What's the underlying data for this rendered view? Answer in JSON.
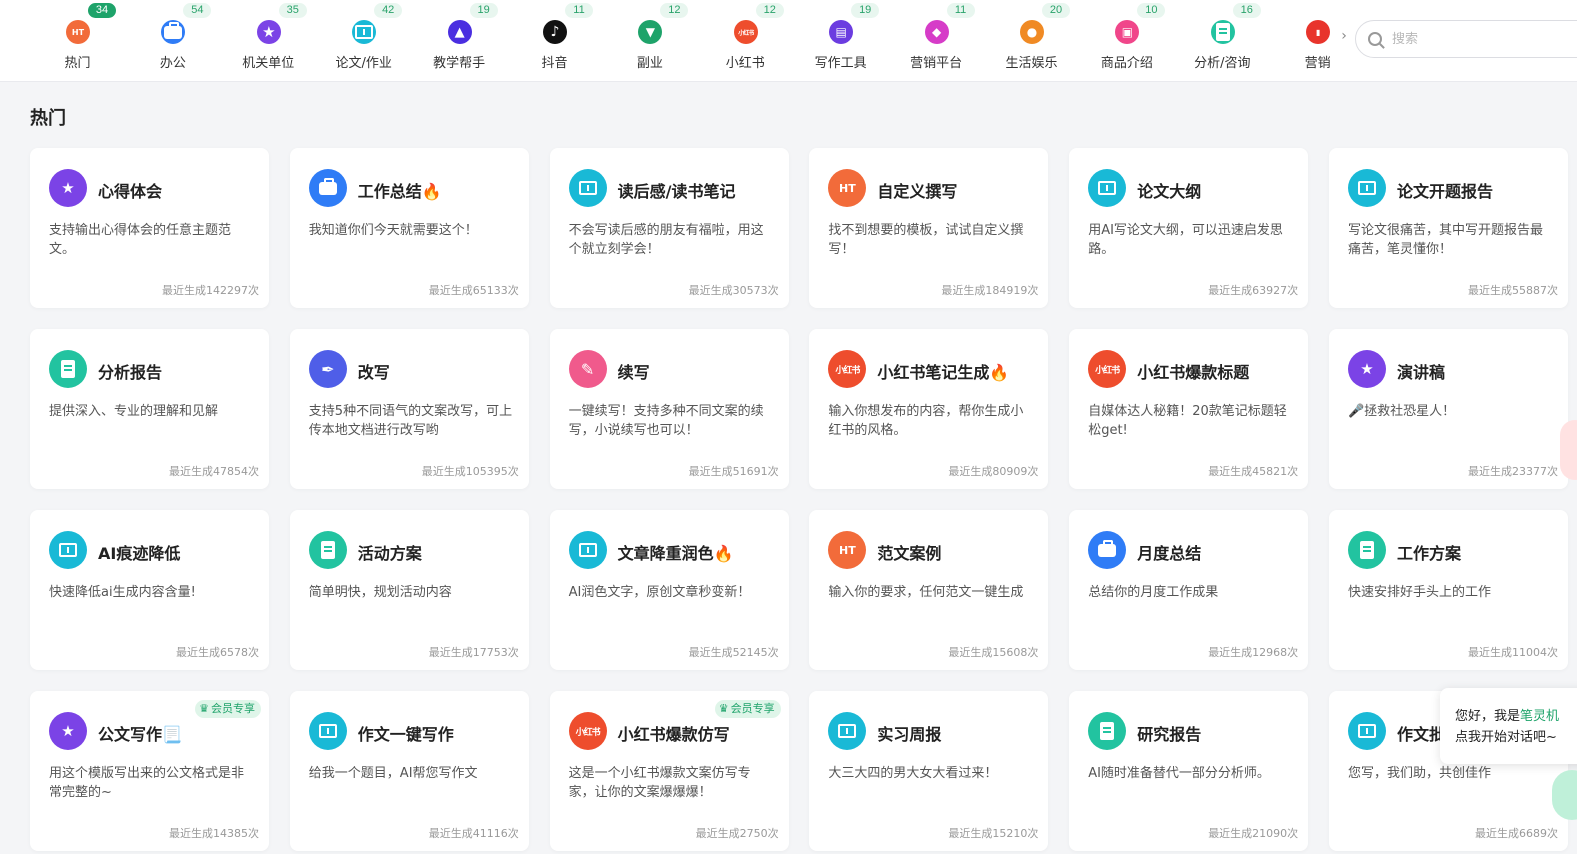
{
  "categories": [
    {
      "label": "热门",
      "badge": "34",
      "color": "#f26b3a",
      "glyph": "HT",
      "badge_dark": true
    },
    {
      "label": "办公",
      "badge": "54",
      "color": "#2f7cf6",
      "glyph": "briefcase"
    },
    {
      "label": "机关单位",
      "badge": "35",
      "color": "#7b43e6",
      "glyph": "star"
    },
    {
      "label": "论文/作业",
      "badge": "42",
      "color": "#19b9d6",
      "glyph": "book"
    },
    {
      "label": "教学帮手",
      "badge": "19",
      "color": "#4a2ee0",
      "glyph": "cap"
    },
    {
      "label": "抖音",
      "badge": "11",
      "color": "#111111",
      "glyph": "note"
    },
    {
      "label": "副业",
      "badge": "12",
      "color": "#1ea36a",
      "glyph": "tie"
    },
    {
      "label": "小红书",
      "badge": "12",
      "color": "#ee4d2d",
      "glyph": "xhs"
    },
    {
      "label": "写作工具",
      "badge": "19",
      "color": "#6b3ce0",
      "glyph": "notebook"
    },
    {
      "label": "营销平台",
      "badge": "11",
      "color": "#d63cc8",
      "glyph": "tag"
    },
    {
      "label": "生活娱乐",
      "badge": "20",
      "color": "#f08a24",
      "glyph": "mic"
    },
    {
      "label": "商品介绍",
      "badge": "10",
      "color": "#f0468a",
      "glyph": "bag"
    },
    {
      "label": "分析/咨询",
      "badge": "16",
      "color": "#22c3a0",
      "glyph": "doc"
    },
    {
      "label": "营销",
      "badge": "",
      "color": "#e8342c",
      "glyph": "chart"
    }
  ],
  "search": {
    "placeholder": "搜索"
  },
  "section": {
    "title": "热门"
  },
  "cards": [
    {
      "title": "心得体会",
      "desc": "支持输出心得体会的任意主题范文。",
      "count": "最近生成142297次",
      "icon": "star",
      "color": "#7b43e6"
    },
    {
      "title": "工作总结🔥",
      "desc": "我知道你们今天就需要这个！",
      "count": "最近生成65133次",
      "icon": "briefcase",
      "color": "#2f7cf6"
    },
    {
      "title": "读后感/读书笔记",
      "desc": "不会写读后感的朋友有福啦，用这个就立刻学会！",
      "count": "最近生成30573次",
      "icon": "book",
      "color": "#19b9d6"
    },
    {
      "title": "自定义撰写",
      "desc": "找不到想要的模板，试试自定义撰写！",
      "count": "最近生成184919次",
      "icon": "HT",
      "color": "#f26b3a"
    },
    {
      "title": "论文大纲",
      "desc": "用AI写论文大纲，可以迅速启发思路。",
      "count": "最近生成63927次",
      "icon": "book",
      "color": "#19b9d6"
    },
    {
      "title": "论文开题报告",
      "desc": "写论文很痛苦，其中写开题报告最痛苦，笔灵懂你！",
      "count": "最近生成55887次",
      "icon": "book",
      "color": "#19b9d6"
    },
    {
      "title": "分析报告",
      "desc": "提供深入、专业的理解和见解",
      "count": "最近生成47854次",
      "icon": "doc",
      "color": "#22c3a0"
    },
    {
      "title": "改写",
      "desc": "支持5种不同语气的文案改写，可上传本地文档进行改写哟",
      "count": "最近生成105395次",
      "icon": "feather",
      "color": "#4f5ee8"
    },
    {
      "title": "续写",
      "desc": "一键续写！支持多种不同文案的续写，小说续写也可以！",
      "count": "最近生成51691次",
      "icon": "pen",
      "color": "#f05a8c"
    },
    {
      "title": "小红书笔记生成🔥",
      "desc": "输入你想发布的内容，帮你生成小红书的风格。",
      "count": "最近生成80909次",
      "icon": "xhs",
      "color": "#ee4d2d"
    },
    {
      "title": "小红书爆款标题",
      "desc": "自媒体达人秘籍！20款笔记标题轻松get!",
      "count": "最近生成45821次",
      "icon": "xhs",
      "color": "#ee4d2d"
    },
    {
      "title": "演讲稿",
      "desc": "🎤拯救社恐星人！",
      "count": "最近生成23377次",
      "icon": "star",
      "color": "#7b43e6"
    },
    {
      "title": "AI痕迹降低",
      "desc": "快速降低ai生成内容含量!",
      "count": "最近生成6578次",
      "icon": "book",
      "color": "#19b9d6"
    },
    {
      "title": "活动方案",
      "desc": "简单明快，规划活动内容",
      "count": "最近生成17753次",
      "icon": "doc",
      "color": "#22c3a0"
    },
    {
      "title": "文章降重润色🔥",
      "desc": "AI润色文字，原创文章秒变新！",
      "count": "最近生成52145次",
      "icon": "book",
      "color": "#19b9d6"
    },
    {
      "title": "范文案例",
      "desc": "输入你的要求，任何范文一键生成",
      "count": "最近生成15608次",
      "icon": "HT",
      "color": "#f26b3a"
    },
    {
      "title": "月度总结",
      "desc": "总结你的月度工作成果",
      "count": "最近生成12968次",
      "icon": "briefcase",
      "color": "#2f7cf6"
    },
    {
      "title": "工作方案",
      "desc": "快速安排好手头上的工作",
      "count": "最近生成11004次",
      "icon": "doc",
      "color": "#22c3a0"
    },
    {
      "title": "公文写作📃",
      "desc": "用这个模版写出来的公文格式是非常完整的~",
      "count": "最近生成14385次",
      "icon": "star",
      "color": "#7b43e6",
      "vip": "会员专享"
    },
    {
      "title": "作文一键写作",
      "desc": "给我一个题目，AI帮您写作文",
      "count": "最近生成41116次",
      "icon": "book",
      "color": "#19b9d6"
    },
    {
      "title": "小红书爆款仿写",
      "desc": "这是一个小红书爆款文案仿写专家，让你的文案爆爆爆！",
      "count": "最近生成2750次",
      "icon": "xhs",
      "color": "#ee4d2d",
      "vip": "会员专享"
    },
    {
      "title": "实习周报",
      "desc": "大三大四的男大女大看过来！",
      "count": "最近生成15210次",
      "icon": "book",
      "color": "#19b9d6"
    },
    {
      "title": "研究报告",
      "desc": "AI随时准备替代一部分分析师。",
      "count": "最近生成21090次",
      "icon": "doc",
      "color": "#22c3a0"
    },
    {
      "title": "作文批",
      "desc": "您写，我们助，共创佳作",
      "count": "最近生成6689次",
      "icon": "book",
      "color": "#19b9d6"
    }
  ],
  "chat": {
    "greeting": "您好，我是",
    "bot_name": "笔灵机",
    "line2": "点我开始对话吧~"
  }
}
